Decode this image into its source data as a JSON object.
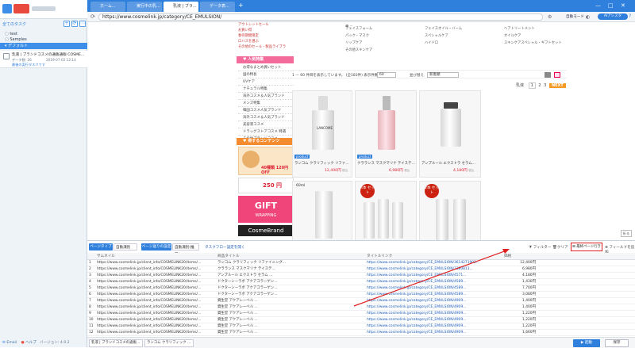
{
  "app": {
    "left_actions": [
      "+",
      "⟳",
      "⋯"
    ],
    "tree_header": "全てのタスク",
    "tree": [
      "test",
      "Samples",
      "デフォルト"
    ],
    "task": {
      "name": "乳液 | ブランドコスメの通販通販 COSMEL...",
      "meta1": "データ数: 26",
      "meta2": "2019-07-02 12:14",
      "status": "最後の実行タスクです"
    },
    "footer": {
      "support": "Email",
      "help": "ヘルプ",
      "version": "バージョン: 4.9.2"
    }
  },
  "browser": {
    "tabs": [
      "ホーム...",
      "実行中の乳...",
      "乳液 | ブラ...",
      "データ表..."
    ],
    "url": "https://www.cosmelink.jp/category/CE_EMULSION/",
    "btn_auto": "自動モード",
    "btn_ai": "AIアシスタ",
    "help_icon": "?"
  },
  "site": {
    "side_small": [
      "アウトレットセール",
      "お買い得",
      "春待期間限定",
      "ロハスを選ぶ",
      "その他のセール・製品ライブラ"
    ],
    "popular_head": "♥ 人気特集",
    "popular": [
      "お得なまとめ買いセット",
      "国の特長",
      "UVケア",
      "ナチュラル特集",
      "海外コスメ＆人気ブランド",
      "メンズ特集",
      "韓国コスメ人気ブランド",
      "海外コスメ＆人気ブランド",
      "美容液コスメ",
      "ドラッグストアコスメ 特選",
      "その他ブランドコスメ"
    ],
    "content_head": "♥ 得するコンテンツ",
    "banner1": "40種類 120円 OFF",
    "banner2": "250 円",
    "banner3": [
      "GIFT",
      "WRAPPING"
    ],
    "banner4": "CosmeBrand",
    "cat_col1": [
      "フェイスフォーム",
      "パック・マスク",
      "リップケア",
      "その他スキンケア"
    ],
    "cat_col2": [
      "フェイスオイル・バーム",
      "スペシャルケア",
      "ハイドロ",
      ""
    ],
    "cat_col3": [
      "ヘアトリートメント",
      "オイルケア",
      "スキンケアスペシャル・ギフトセット",
      ""
    ],
    "toolbar_text": "1 — 60 件目を表示しています。 (全183件) 表示件数",
    "per_page": "60",
    "sort_label": "並び替え",
    "sort_value": "新着順",
    "pager": [
      "1",
      "2",
      "3",
      "NEXT"
    ],
    "pager_prefix": "乳液",
    "products": [
      {
        "tag": "LANCOME",
        "name": "ランコム クラリフィック リファイニング ミ...",
        "price": "12,400円"
      },
      {
        "tag": "LANCOME",
        "name": "クラランス マスクマリナ テイステマ...",
        "price": "6,980円"
      },
      {
        "tag": "",
        "name": "アンプルール エクストラ セラム...",
        "price": "4,180円"
      },
      {
        "tag": "",
        "name": "",
        "price": ""
      },
      {
        "tag": "4本 セット",
        "name": "",
        "price": ""
      },
      {
        "tag": "2本 セット",
        "name": "",
        "price": ""
      }
    ],
    "product_badge": "product",
    "price_suffix": "税込",
    "sixty_label": "60ml"
  },
  "panel": {
    "btn_pagetype": "ページタイプ",
    "btn_select1": "自動識別",
    "btn_pagemode": "ページ送りの設定",
    "btn_select2": "自動識別(推奨)",
    "link_flow": "タスクフロー設定を開く",
    "filter": "フィルター",
    "clear": "クリア",
    "dedup": "最終ページ行き",
    "addfield": "フィールドを追加",
    "close": "折る",
    "columns": [
      "",
      "サムネイル",
      "商品タイトル",
      "タイトルリンク",
      "価格"
    ],
    "rows": [
      [
        "1",
        "https://www.cosmelink.jp/client_info/COSMELINK20/items/...",
        "ランコム クラリフィック リファイニング...",
        "https://www.cosmelink.jp/category/CE_EMULSION/3614271902...",
        "12,400円"
      ],
      [
        "2",
        "https://www.cosmelink.jp/client_info/COSMELINK20/items/...",
        "クラランス マスクマリナ テイステ...",
        "https://www.cosmelink.jp/category/CE_EMULSION/3380811...",
        "6,980円"
      ],
      [
        "3",
        "https://www.cosmelink.jp/client_info/COSMELINK20/items/...",
        "アンプルール エクストラ セラム ...",
        "https://www.cosmelink.jp/category/CE_EMULSION/4571...",
        "4,180円"
      ],
      [
        "4",
        "https://www.cosmelink.jp/client_info/COSMELINK20/items/...",
        "ドクターシーラボ アクアコラーゲン...",
        "https://www.cosmelink.jp/category/CE_EMULSION/4589...",
        "1,430円"
      ],
      [
        "5",
        "https://www.cosmelink.jp/client_info/COSMELINK20/items/...",
        "ドクターシーラボ アクアコラーゲン...",
        "https://www.cosmelink.jp/category/CE_EMULSION/4589...",
        "7,700円"
      ],
      [
        "6",
        "https://www.cosmelink.jp/client_info/COSMELINK20/items/...",
        "ドクターシーラボ アクアコラーゲン...",
        "https://www.cosmelink.jp/category/CE_EMULSION/4589...",
        "3,080円"
      ],
      [
        "7",
        "https://www.cosmelink.jp/client_info/COSMELINK20/items/...",
        "資生堂 アクアレーベル ...",
        "https://www.cosmelink.jp/category/CE_EMULSION/4909...",
        "1,400円"
      ],
      [
        "8",
        "https://www.cosmelink.jp/client_info/COSMELINK20/items/...",
        "資生堂 アクアレーベル ...",
        "https://www.cosmelink.jp/category/CE_EMULSION/4909...",
        "1,400円"
      ],
      [
        "9",
        "https://www.cosmelink.jp/client_info/COSMELINK20/items/...",
        "資生堂 アクアレーベル ...",
        "https://www.cosmelink.jp/category/CE_EMULSION/4909...",
        "1,220円"
      ],
      [
        "10",
        "https://www.cosmelink.jp/client_info/COSMELINK20/items/...",
        "資生堂 アクアレーベル ...",
        "https://www.cosmelink.jp/category/CE_EMULSION/4909...",
        "1,220円"
      ],
      [
        "11",
        "https://www.cosmelink.jp/client_info/COSMELINK20/items/...",
        "資生堂 アクアレーベル ...",
        "https://www.cosmelink.jp/category/CE_EMULSION/4909...",
        "1,220円"
      ],
      [
        "12",
        "https://www.cosmelink.jp/client_info/COSMELINK20/items/...",
        "資生堂 アクアレーベル ...",
        "https://www.cosmelink.jp/category/CE_EMULSION/4909...",
        "1,660円"
      ]
    ],
    "status_tabs": [
      "乳液 | ブランドコスメの通販通...",
      "ランコム クラリフィック ミ..."
    ],
    "start_btn": "▶ 起動",
    "save_btn": "保存"
  },
  "colors": {
    "primary": "#2f7fdc",
    "pink": "#f26b9a",
    "annotation": "#e02020"
  }
}
